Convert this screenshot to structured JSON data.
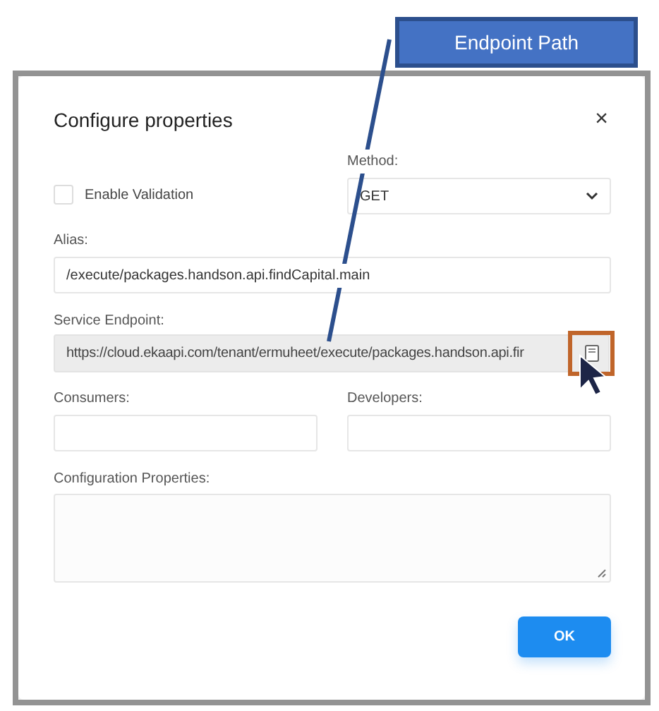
{
  "callout": {
    "text": "Endpoint Path"
  },
  "dialog": {
    "title": "Configure properties",
    "close": "×",
    "validation": {
      "label": "Enable Validation",
      "checked": false
    },
    "method": {
      "label": "Method:",
      "value": "GET"
    },
    "alias": {
      "label": "Alias:",
      "value": "/execute/packages.handson.api.findCapital.main"
    },
    "endpoint": {
      "label": "Service Endpoint:",
      "value": "https://cloud.ekaapi.com/tenant/ermuheet/execute/packages.handson.api.fir",
      "disabled": true
    },
    "consumers": {
      "label": "Consumers:"
    },
    "developers": {
      "label": "Developers:"
    },
    "config": {
      "label": "Configuration Properties:"
    },
    "ok": "OK"
  }
}
